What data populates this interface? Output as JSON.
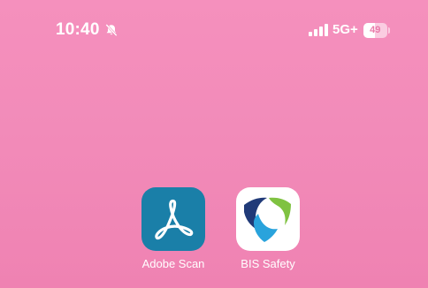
{
  "status_bar": {
    "time": "10:40",
    "silent_icon": "bell-slash-icon",
    "signal_icon": "cellular-signal-icon",
    "network": "5G+",
    "battery_level": "49",
    "battery_fraction": 0.49
  },
  "home_screen": {
    "apps": [
      {
        "label": "Adobe Scan",
        "icon": "adobe-acrobat-icon",
        "tile_color": "#1a7fa8"
      },
      {
        "label": "BIS Safety",
        "icon": "bis-safety-shield-icon",
        "tile_color": "#ffffff"
      }
    ]
  },
  "colors": {
    "wallpaper": "#f28bb9",
    "text": "#ffffff"
  }
}
